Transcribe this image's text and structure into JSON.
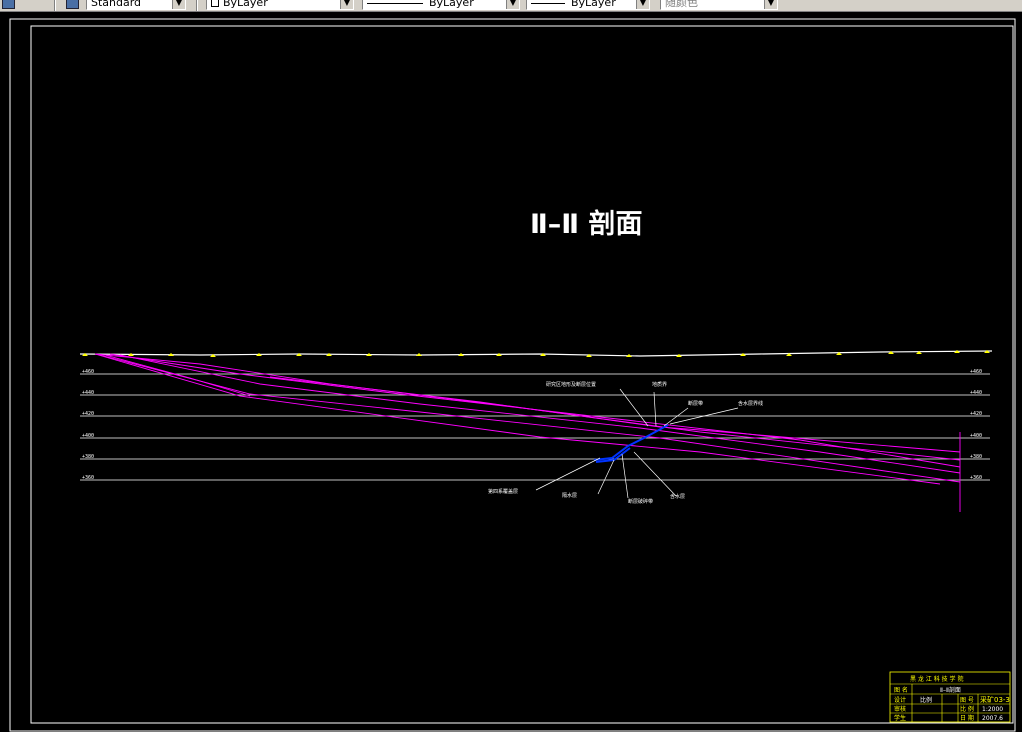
{
  "toolbar": {
    "text_style": "Standard",
    "layer": "ByLayer",
    "linetype": "ByLayer",
    "lineweight": "ByLayer",
    "plot_style": "随颜色"
  },
  "drawing": {
    "title": "Ⅱ–Ⅱ 剖面",
    "elevations_left": [
      "+460",
      "+440",
      "+420",
      "+400",
      "+380",
      "+360"
    ],
    "elevations_right": [
      "+460",
      "+440",
      "+420",
      "+400",
      "+380",
      "+360"
    ],
    "callouts": {
      "c1": "研究区地形及断层位置",
      "c2": "地质界",
      "c3": "断层带",
      "c4": "含水层界线",
      "c5": "第四系覆盖层",
      "c6": "隔水层",
      "c7": "断层破碎带",
      "c8": "含水层"
    },
    "colors": {
      "background": "#000000",
      "frame": "#ffffff",
      "strata": "#ff00ff",
      "fault": "#0000ff",
      "title_block_text": "#ffff00"
    }
  },
  "title_block": {
    "school": "黑 龙 江 科 技 学 院",
    "row_label_1": "图 名",
    "drawing_name": "Ⅱ–Ⅱ剖面",
    "row_label_2": "比例",
    "scale_label": "比 例",
    "scale": "1:2000",
    "drawing_no_label": "图 号",
    "drawing_no": "采矿03-3",
    "date_label": "日 期",
    "date": "2007.6",
    "designer": "设计",
    "checker": "审核",
    "student": "学生"
  }
}
